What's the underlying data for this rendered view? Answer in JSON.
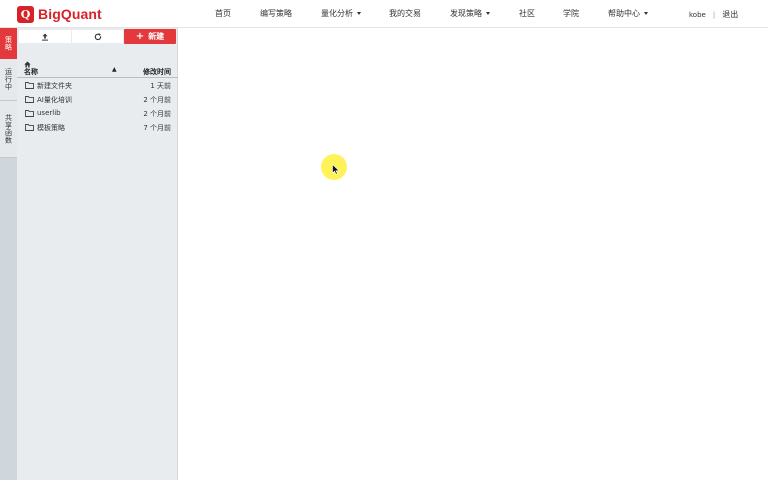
{
  "brand": {
    "mark": "Q",
    "name": "BigQuant",
    "color": "#d8222a"
  },
  "nav": {
    "home": "首页",
    "write_strategy": "编写策略",
    "quant_analysis": "量化分析",
    "my_trading": "我的交易",
    "discover_strategy": "发现策略",
    "community": "社区",
    "academy": "学院",
    "help_center": "帮助中心"
  },
  "user": {
    "name": "kobe",
    "separator": "|",
    "logout": "退出"
  },
  "side_tabs": {
    "tab1": "策略",
    "tab2": "运行中",
    "tab3": "共享函数"
  },
  "panel": {
    "new_button": "新建",
    "columns": {
      "name": "名称",
      "sort_indicator": "▲",
      "modified": "修改时间"
    },
    "rows": [
      {
        "name": "新建文件夹",
        "modified": "1 天前"
      },
      {
        "name": "AI量化培训",
        "modified": "2 个月前"
      },
      {
        "name": "userlib",
        "modified": "2 个月前"
      },
      {
        "name": "模板策略",
        "modified": "7 个月前"
      }
    ]
  },
  "icons": {
    "upload": "upload-icon",
    "refresh": "refresh-icon",
    "plus": "plus-icon",
    "home": "home-icon",
    "folder": "folder-icon"
  },
  "colors": {
    "accent": "#e4393c",
    "panel_bg": "#e8ecef",
    "tab_strip": "#cfd6dc"
  }
}
